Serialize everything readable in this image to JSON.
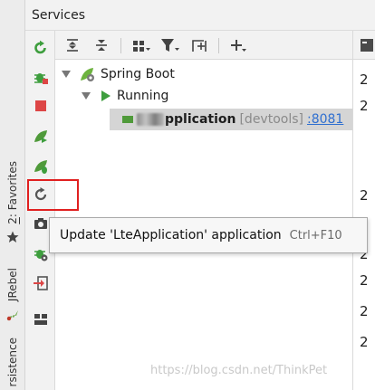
{
  "window": {
    "title": "Services"
  },
  "left_stripe": {
    "favorites_number": "2",
    "favorites_label": ": Favorites",
    "jrebel_label": "JRebel",
    "persistence_label": "rsistence"
  },
  "tree": {
    "spring_boot_label": "Spring Boot",
    "running_label": "Running",
    "app_name": "pplication",
    "devtools_label": "[devtools]",
    "port_label": ":8081"
  },
  "tooltip": {
    "text": "Update 'LteApplication' application",
    "shortcut": "Ctrl+F10"
  },
  "right_gutter": {
    "values": [
      "2",
      "2",
      "2",
      "2",
      "2",
      "2",
      "2",
      "2"
    ]
  },
  "watermark": "https://blog.csdn.net/ThinkPet",
  "colors": {
    "run_green": "#3e9e3e",
    "stop_red": "#dd4646",
    "highlight_red": "#e02020",
    "selection_gray": "#d5d5d5",
    "link_blue": "#2f6fd0"
  }
}
